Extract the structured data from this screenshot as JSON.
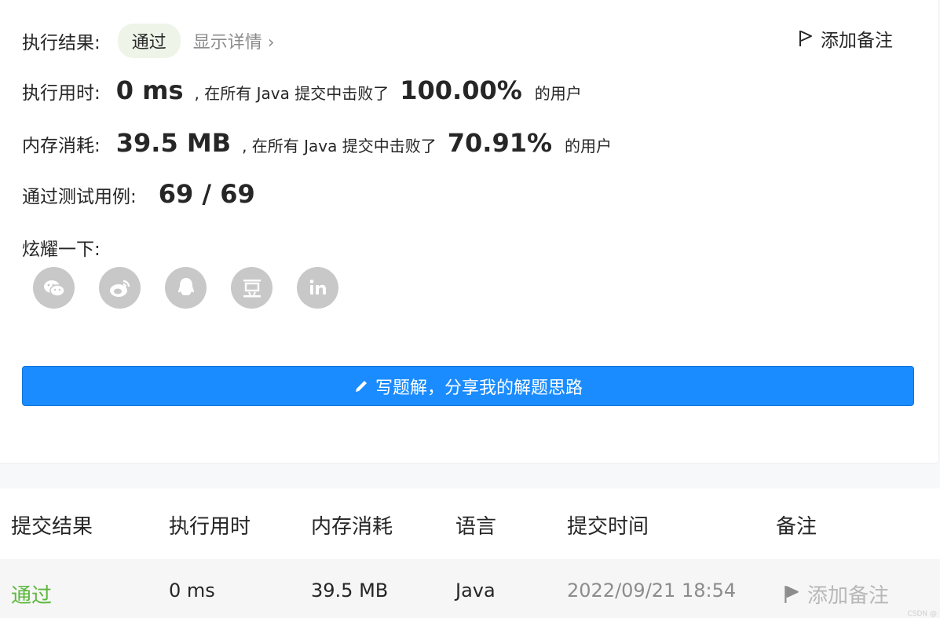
{
  "result": {
    "label": "执行结果:",
    "status": "通过",
    "detail": "显示详情 ›",
    "add_note": "添加备注"
  },
  "runtime": {
    "label": "执行用时:",
    "value": "0 ms",
    "mid": ", 在所有 Java 提交中击败了",
    "percent": "100.00%",
    "suffix": "的用户"
  },
  "memory": {
    "label": "内存消耗:",
    "value": "39.5 MB",
    "mid": ", 在所有 Java 提交中击败了",
    "percent": "70.91%",
    "suffix": "的用户"
  },
  "tests": {
    "label": "通过测试用例:",
    "value": "69 / 69"
  },
  "share": {
    "label": "炫耀一下:",
    "icons": [
      "wechat-icon",
      "weibo-icon",
      "qq-icon",
      "douban-icon",
      "linkedin-icon"
    ]
  },
  "solution_button": "写题解，分享我的解题思路",
  "table": {
    "headers": [
      "提交结果",
      "执行用时",
      "内存消耗",
      "语言",
      "提交时间",
      "备注"
    ],
    "rows": [
      {
        "result": "通过",
        "time": "0 ms",
        "memory": "39.5 MB",
        "lang": "Java",
        "submitted": "2022/09/21 18:54",
        "note": "添加备注"
      }
    ]
  },
  "watermark": "CSDN @",
  "colors": {
    "accent": "#1a8cff",
    "success": "#5cb83c",
    "muted": "#8c8c8c"
  }
}
